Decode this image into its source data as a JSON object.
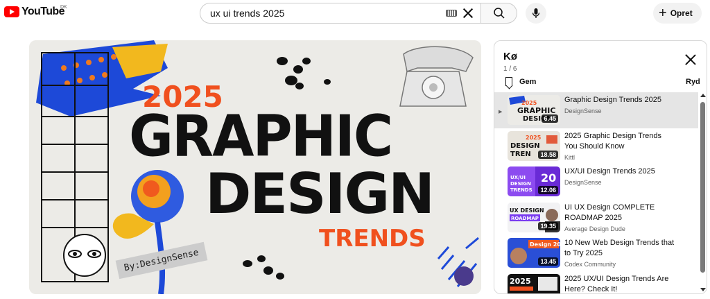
{
  "header": {
    "logo_text": "YouTube",
    "logo_country": "DK",
    "search_value": "ux ui trends 2025",
    "create_label": "Opret"
  },
  "player": {
    "thumb_year": "2025",
    "thumb_line1": "GRAPHIC",
    "thumb_line2": "DESIGN",
    "thumb_line3": "TRENDS",
    "thumb_credit": "By:DesignSense"
  },
  "queue": {
    "title": "Kø",
    "position": "1 / 6",
    "save_label": "Gem",
    "clear_label": "Ryd",
    "items": [
      {
        "title": "Graphic Design Trends 2025",
        "channel": "DesignSense",
        "duration": "6.45",
        "active": true
      },
      {
        "title": "2025 Graphic Design Trends You Should Know",
        "channel": "Kittl",
        "duration": "18.58",
        "active": false
      },
      {
        "title": "UX/UI Design Trends 2025",
        "channel": "DesignSense",
        "duration": "12.06",
        "active": false
      },
      {
        "title": "UI UX Design COMPLETE ROADMAP 2025",
        "channel": "Average Design Dude",
        "duration": "19.35",
        "active": false
      },
      {
        "title": "10 New Web Design Trends that to Try 2025",
        "channel": "Codex Community",
        "duration": "13.45",
        "active": false
      },
      {
        "title": "2025 UX/UI Design Trends Are Here? Check It!",
        "channel": "",
        "duration": "",
        "active": false
      }
    ]
  },
  "colors": {
    "brand": "#ff0000",
    "accent_orange": "#f0501e",
    "active_row": "#e5e5e5"
  }
}
